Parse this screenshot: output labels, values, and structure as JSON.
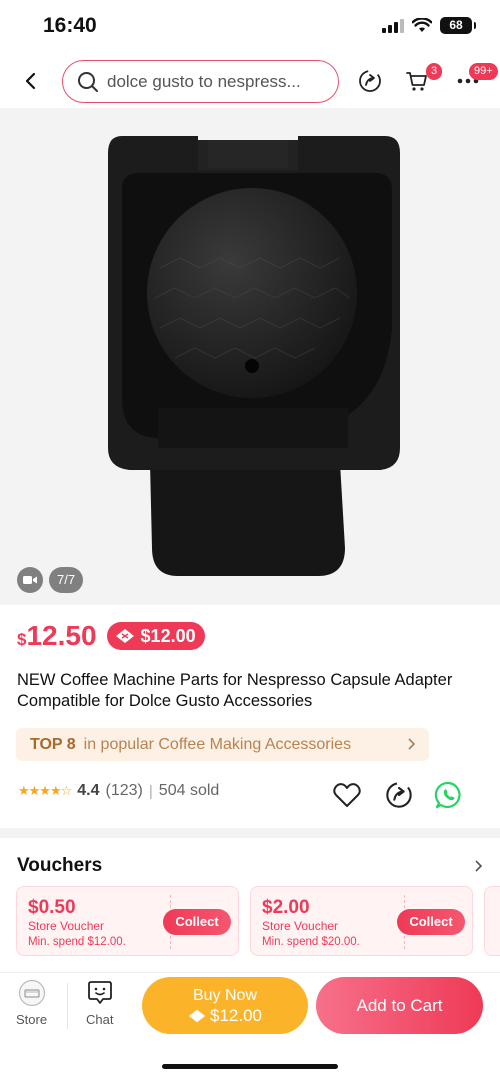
{
  "status": {
    "time": "16:40",
    "battery": "68"
  },
  "header": {
    "search_text": "dolce gusto to nespress...",
    "cart_badge": "3",
    "more_badge": "99+"
  },
  "media": {
    "page_indicator": "7/7"
  },
  "product": {
    "currency": "$",
    "price": "12.50",
    "coupon_price": "$12.00",
    "title": "NEW Coffee Machine Parts for Nespresso Capsule Adapter Compatible for Dolce Gusto Accessories",
    "rank_top": "TOP 8",
    "rank_text": "in popular Coffee Making Accessories",
    "rating": "4.4",
    "rating_count": "(123)",
    "sold": "504 sold",
    "stars_filled": 4.4
  },
  "vouchers": {
    "heading": "Vouchers",
    "items": [
      {
        "amount": "$0.50",
        "type": "Store Voucher",
        "min_spend": "Min. spend $12.00.",
        "button": "Collect"
      },
      {
        "amount": "$2.00",
        "type": "Store Voucher",
        "min_spend": "Min. spend $20.00.",
        "button": "Collect"
      }
    ]
  },
  "bottom_bar": {
    "store_label": "Store",
    "chat_label": "Chat",
    "buy_now_label": "Buy Now",
    "buy_now_price": "$12.00",
    "add_to_cart_label": "Add to Cart"
  },
  "colors": {
    "accent": "#ee3a57",
    "buy_now": "#fbb42a",
    "rank_bg": "#fdf1e5",
    "whatsapp": "#25d366"
  }
}
